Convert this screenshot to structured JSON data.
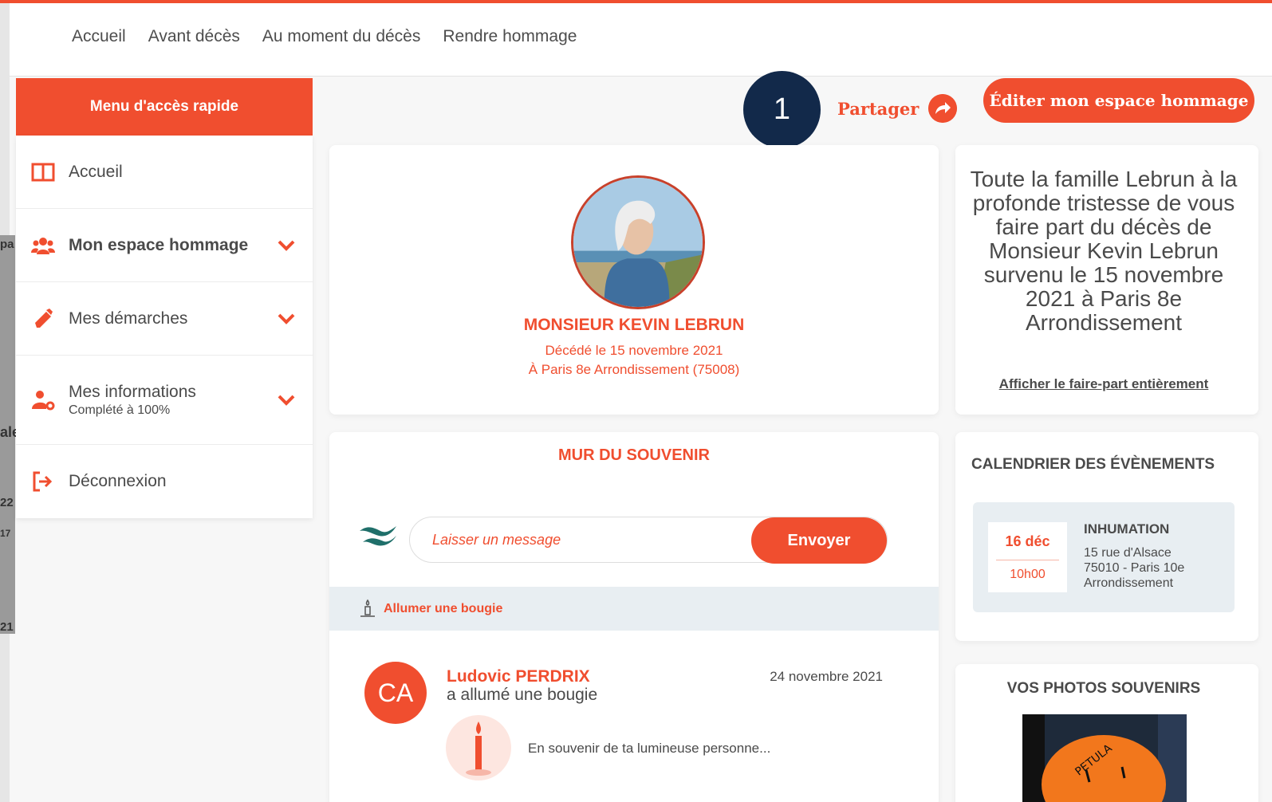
{
  "nav": {
    "items": [
      "Accueil",
      "Avant décès",
      "Au moment du décès",
      "Rendre hommage"
    ]
  },
  "ghost": {
    "t1": "pa",
    "t2": "ale",
    "t3": "22",
    "t4": "17",
    "t5": "21"
  },
  "sidebar": {
    "header": "Menu d'accès rapide",
    "items": [
      {
        "label": "Accueil",
        "icon": "layout-icon"
      },
      {
        "label": "Mon espace hommage",
        "icon": "users-icon"
      },
      {
        "label": "Mes démarches",
        "icon": "pen-icon"
      },
      {
        "label": "Mes informations",
        "sub": "Complété à 100%",
        "icon": "user-gear-icon"
      },
      {
        "label": "Déconnexion",
        "icon": "logout-icon"
      }
    ]
  },
  "share": {
    "badge": "1",
    "label": "Partager"
  },
  "profile": {
    "name": "MONSIEUR KEVIN LEBRUN",
    "death_date": "Décédé le 15 novembre 2021",
    "death_place": "À Paris 8e Arrondissement (75008)"
  },
  "wall": {
    "title": "MUR DU SOUVENIR",
    "input_placeholder": "Laisser un message",
    "send_label": "Envoyer",
    "candle_label": "Allumer une bougie",
    "post": {
      "initials": "CA",
      "author": "Ludovic PERDRIX",
      "action": "a allumé une bougie",
      "date": "24 novembre 2021",
      "text": "En souvenir de ta lumineuse personne..."
    }
  },
  "edit_button": "Éditer mon espace hommage",
  "faire_part": {
    "text": "Toute la famille Lebrun à la profonde tristesse de vous faire part du décès de Monsieur Kevin Lebrun survenu le 15 novembre 2021 à Paris 8e Arrondissement",
    "link": "Afficher le faire-part entièrement"
  },
  "calendar": {
    "title": "CALENDRIER DES ÉVÈNEMENTS",
    "event": {
      "day": "16 déc",
      "time": "10h00",
      "type": "INHUMATION",
      "addr1": "15 rue d'Alsace",
      "addr2": "75010 - Paris 10e",
      "addr3": "Arrondissement"
    }
  },
  "photos": {
    "title": "VOS PHOTOS SOUVENIRS",
    "photo_text": "PETULA"
  },
  "colors": {
    "accent": "#f04e2f",
    "navy": "#12294a",
    "panel": "#e8eef2"
  }
}
